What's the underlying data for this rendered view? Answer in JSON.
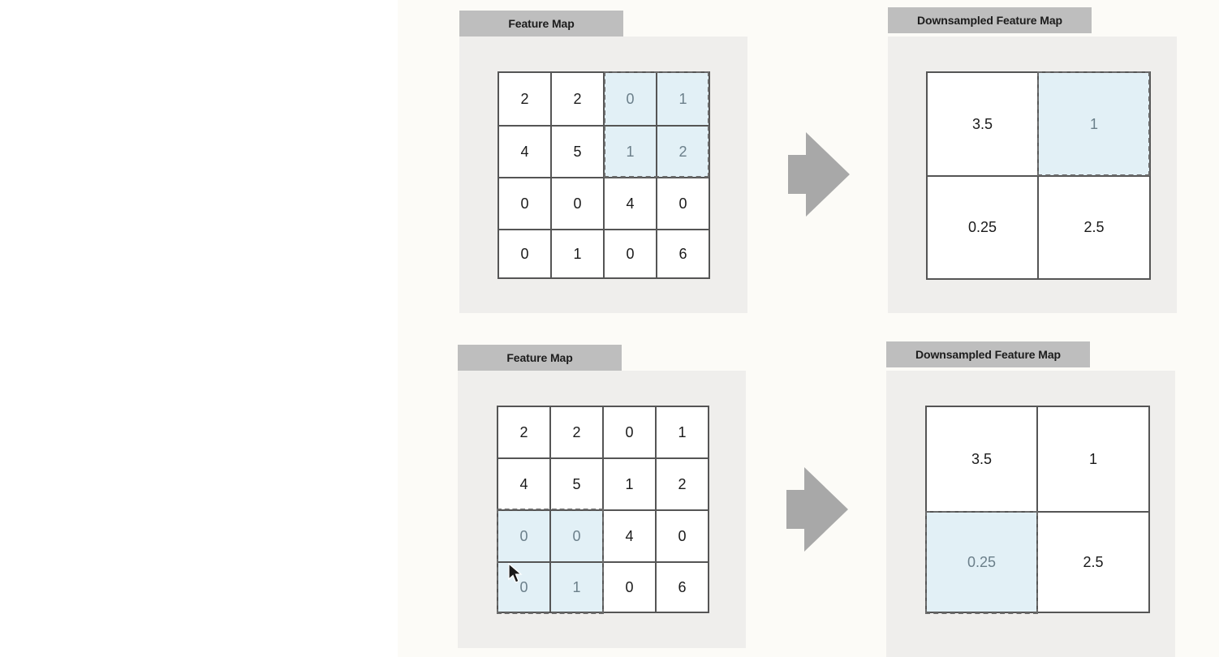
{
  "diagrams": [
    {
      "feature_map": {
        "title": "Feature Map",
        "rows": [
          [
            "2",
            "2",
            "0",
            "1"
          ],
          [
            "4",
            "5",
            "1",
            "2"
          ],
          [
            "0",
            "0",
            "4",
            "0"
          ],
          [
            "0",
            "1",
            "0",
            "6"
          ]
        ]
      },
      "downsampled": {
        "title": "Downsampled Feature Map",
        "rows": [
          [
            "3.5",
            "1"
          ],
          [
            "0.25",
            "2.5"
          ]
        ]
      }
    },
    {
      "feature_map": {
        "title": "Feature Map",
        "rows": [
          [
            "2",
            "2",
            "0",
            "1"
          ],
          [
            "4",
            "5",
            "1",
            "2"
          ],
          [
            "0",
            "0",
            "4",
            "0"
          ],
          [
            "0",
            "1",
            "0",
            "6"
          ]
        ]
      },
      "downsampled": {
        "title": "Downsampled Feature Map",
        "rows": [
          [
            "3.5",
            "1"
          ],
          [
            "0.25",
            "2.5"
          ]
        ]
      }
    }
  ],
  "colors": {
    "highlight": "#e2f0f6",
    "arrow": "#a8a8a8",
    "panel": "#efeeec",
    "tab": "#bebebe"
  },
  "icons": {
    "arrow": "right-arrow-icon",
    "cursor": "mouse-pointer-icon"
  }
}
